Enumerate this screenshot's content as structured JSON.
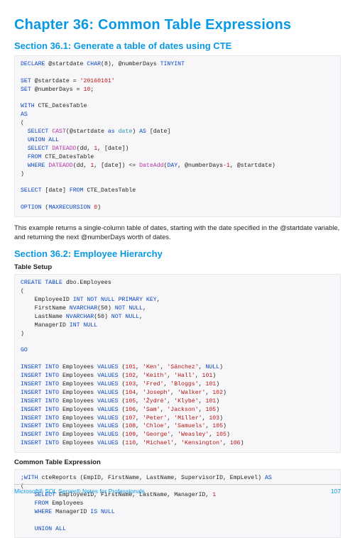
{
  "chapter_title": "Chapter 36: Common Table Expressions",
  "section1": {
    "title": "Section 36.1: Generate a table of dates using CTE",
    "body": "This example returns a single-column table of dates, starting with the date specified in the @startdate variable, and returning the next @numberDays worth of dates."
  },
  "section2": {
    "title": "Section 36.2: Employee Hierarchy",
    "sub_setup": "Table Setup",
    "sub_cte": "Common Table Expression"
  },
  "footer": {
    "left": "Microsoft® SQL Server® Notes for Professionals",
    "right": "107"
  },
  "code": {
    "declare": "DECLARE",
    "char8": "CHAR",
    "char8_paren": "(8)",
    "tinyint": "TINYINT",
    "var_start": "@startdate",
    "var_days": "@numberDays",
    "set": "SET",
    "start_literal": "'20160101'",
    "eq": " = ",
    "days_literal": "10",
    "semicolon": ";",
    "with": "WITH",
    "cte_dates": " CTE_DatesTable",
    "as": "AS",
    "select": "SELECT",
    "cast": "CAST",
    "as_kw": "as",
    "date_col": "date",
    "as_alias": "AS",
    "bracket_date": "[date]",
    "union_all": "UNION ALL",
    "dateadd": "DATEADD",
    "dd": "dd",
    "one": "1",
    "comma": ", ",
    "from": "FROM",
    "where": "WHERE",
    "le": " <= ",
    "dateadd2": "DateAdd",
    "day": "DAY",
    "minus1": "-1",
    "option": "OPTION",
    "maxrecursion": "MAXRECURSION",
    "zero": "0",
    "create_table": "CREATE TABLE",
    "dbo_emp": " dbo.Employees",
    "empid": "EmployeeID ",
    "int": "INT",
    "not_null": "NOT NULL",
    "pk": "PRIMARY KEY",
    "fname": "FirstName ",
    "nvarchar": "NVARCHAR",
    "p50": "(50)",
    "lname": "LastName ",
    "mgr": "ManagerID ",
    "null": "NULL",
    "go": "GO",
    "insert_into": "INSERT INTO",
    "employees": " Employees ",
    "values": "VALUES",
    "rows": [
      {
        "id": "101",
        "fn": "'Ken'",
        "ln": "'Sánchez'",
        "mg": "NULL"
      },
      {
        "id": "102",
        "fn": "'Keith'",
        "ln": "'Hall'",
        "mg": "101"
      },
      {
        "id": "103",
        "fn": "'Fred'",
        "ln": "'Bloggs'",
        "mg": "101"
      },
      {
        "id": "104",
        "fn": "'Joseph'",
        "ln": "'Walker'",
        "mg": "102"
      },
      {
        "id": "105",
        "fn": "'Žydrė'",
        "ln": "'Klybė'",
        "mg": "101"
      },
      {
        "id": "106",
        "fn": "'Sam'",
        "ln": "'Jackson'",
        "mg": "105"
      },
      {
        "id": "107",
        "fn": "'Peter'",
        "ln": "'Miller'",
        "mg": "103"
      },
      {
        "id": "108",
        "fn": "'Chloe'",
        "ln": "'Samuels'",
        "mg": "105"
      },
      {
        "id": "109",
        "fn": "'George'",
        "ln": "'Weasley'",
        "mg": "105"
      },
      {
        "id": "110",
        "fn": "'Michael'",
        "ln": "'Kensington'",
        "mg": "106"
      }
    ],
    "cte2_with": ";WITH",
    "cte2_name": " cteReports (EmpID, FirstName, LastName, SupervisorID, EmpLevel) ",
    "cte2_select_cols": " EmployeeID, FirstName, LastName, ManagerID, ",
    "cte2_from": " Employees",
    "cte2_where": " ManagerID ",
    "is_null": "IS NULL"
  }
}
